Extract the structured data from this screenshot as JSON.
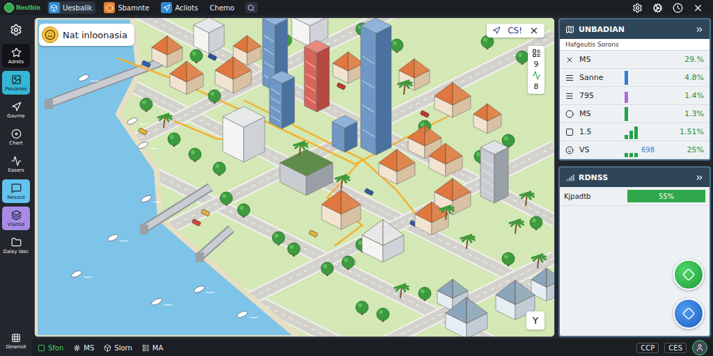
{
  "top_bar": {
    "logo": "Nestbin",
    "tabs": [
      {
        "label": "Uesbalik",
        "selected": true
      },
      {
        "label": "Sbamnte",
        "selected": false
      },
      {
        "label": "Acliots",
        "selected": false
      },
      {
        "label": "Chemo",
        "selected": false
      }
    ]
  },
  "sidebar": {
    "items": [
      {
        "label": "Adrets",
        "selected": false,
        "color": "#121417"
      },
      {
        "label": "Pesseses",
        "selected": true,
        "color": "#35b6d4"
      },
      {
        "label": "Gavrne",
        "selected": false,
        "color": "#23272d"
      },
      {
        "label": "Chert",
        "selected": false,
        "color": "#23272d"
      },
      {
        "label": "Easers",
        "selected": false,
        "color": "#23272d"
      },
      {
        "label": "Nesssd",
        "selected": true,
        "color": "#63c3ee"
      },
      {
        "label": "Vlantid",
        "selected": true,
        "color": "#a98ae6"
      },
      {
        "label": "Daley ldec",
        "selected": false,
        "color": "#23272d"
      }
    ],
    "footer": "Dinerisit"
  },
  "map": {
    "location": "Nat inloonasia",
    "view": "CS!",
    "controls": [
      {
        "label": "9"
      },
      {
        "label": "8"
      }
    ],
    "compass": "Y"
  },
  "stats_panel": {
    "title": "UNBADIAN",
    "subtitle": "Hafgeutis Sorons",
    "rows": [
      {
        "label": "MS",
        "value": "29.%",
        "spark": []
      },
      {
        "label": "Sanne",
        "value": "4.8%",
        "spark": [
          1
        ],
        "color": "#2f7fd6"
      },
      {
        "label": "795",
        "value": "1.4%",
        "spark": [
          0.8
        ],
        "color": "#b06be0"
      },
      {
        "label": "MS",
        "value": "1.3%",
        "spark": [
          1
        ],
        "color": "#22a34a"
      },
      {
        "label": "1.5",
        "value": "1.51%",
        "spark": [
          0.3,
          0.6,
          0.9
        ],
        "color": "#22a34a"
      },
      {
        "label": "VS",
        "value": "25%",
        "spark": [
          0.3,
          0.3,
          0.3
        ],
        "color": "#22a34a",
        "extra": "698"
      }
    ]
  },
  "region_panel": {
    "title": "RDNSS",
    "rows": [
      {
        "label": "Kjpadtb",
        "value": "55%",
        "level": 1
      }
    ]
  },
  "bottom_bar": {
    "left": [
      {
        "label": "Sfon",
        "selected": true
      },
      {
        "label": "MS",
        "selected": false
      },
      {
        "label": "Slorn",
        "selected": false
      },
      {
        "label": "MA",
        "selected": false
      }
    ],
    "right": [
      {
        "label": "CCP"
      },
      {
        "label": "CES"
      }
    ]
  }
}
